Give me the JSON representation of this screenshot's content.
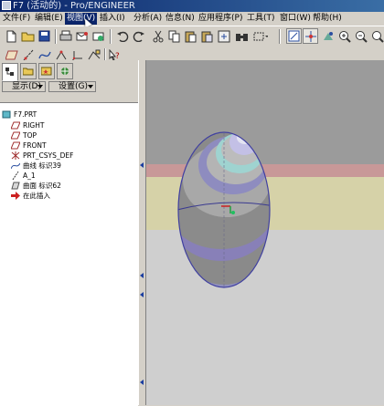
{
  "window": {
    "title": "F7 (活动的) - Pro/ENGINEER"
  },
  "menubar": {
    "items": [
      {
        "label": "文件(F)"
      },
      {
        "label": "编辑(E)"
      },
      {
        "label": "视图(V)"
      },
      {
        "label": "插入(I)"
      },
      {
        "label": "分析(A)"
      },
      {
        "label": "信息(N)"
      },
      {
        "label": "应用程序(P)"
      },
      {
        "label": "工具(T)"
      },
      {
        "label": "窗口(W)"
      },
      {
        "label": "帮助(H)"
      }
    ],
    "active": "视图(V)"
  },
  "panel": {
    "show_label": "显示(D)",
    "settings_label": "设置(G)"
  },
  "tree": {
    "root": "F7.PRT",
    "items": [
      {
        "label": "RIGHT",
        "icon": "datum-plane-icon"
      },
      {
        "label": "TOP",
        "icon": "datum-plane-icon"
      },
      {
        "label": "FRONT",
        "icon": "datum-plane-icon"
      },
      {
        "label": "PRT_CSYS_DEF",
        "icon": "csys-icon"
      },
      {
        "label": "曲线 标识39",
        "icon": "curve-icon"
      },
      {
        "label": "A_1",
        "icon": "axis-icon"
      },
      {
        "label": "曲面 标识62",
        "icon": "surface-icon"
      },
      {
        "label": "在此插入",
        "icon": "insert-here-icon"
      }
    ]
  },
  "colors": {
    "accent": "#0a246a",
    "viewport_bg": "#9a9a9a",
    "datum_red": "#cc3333"
  }
}
